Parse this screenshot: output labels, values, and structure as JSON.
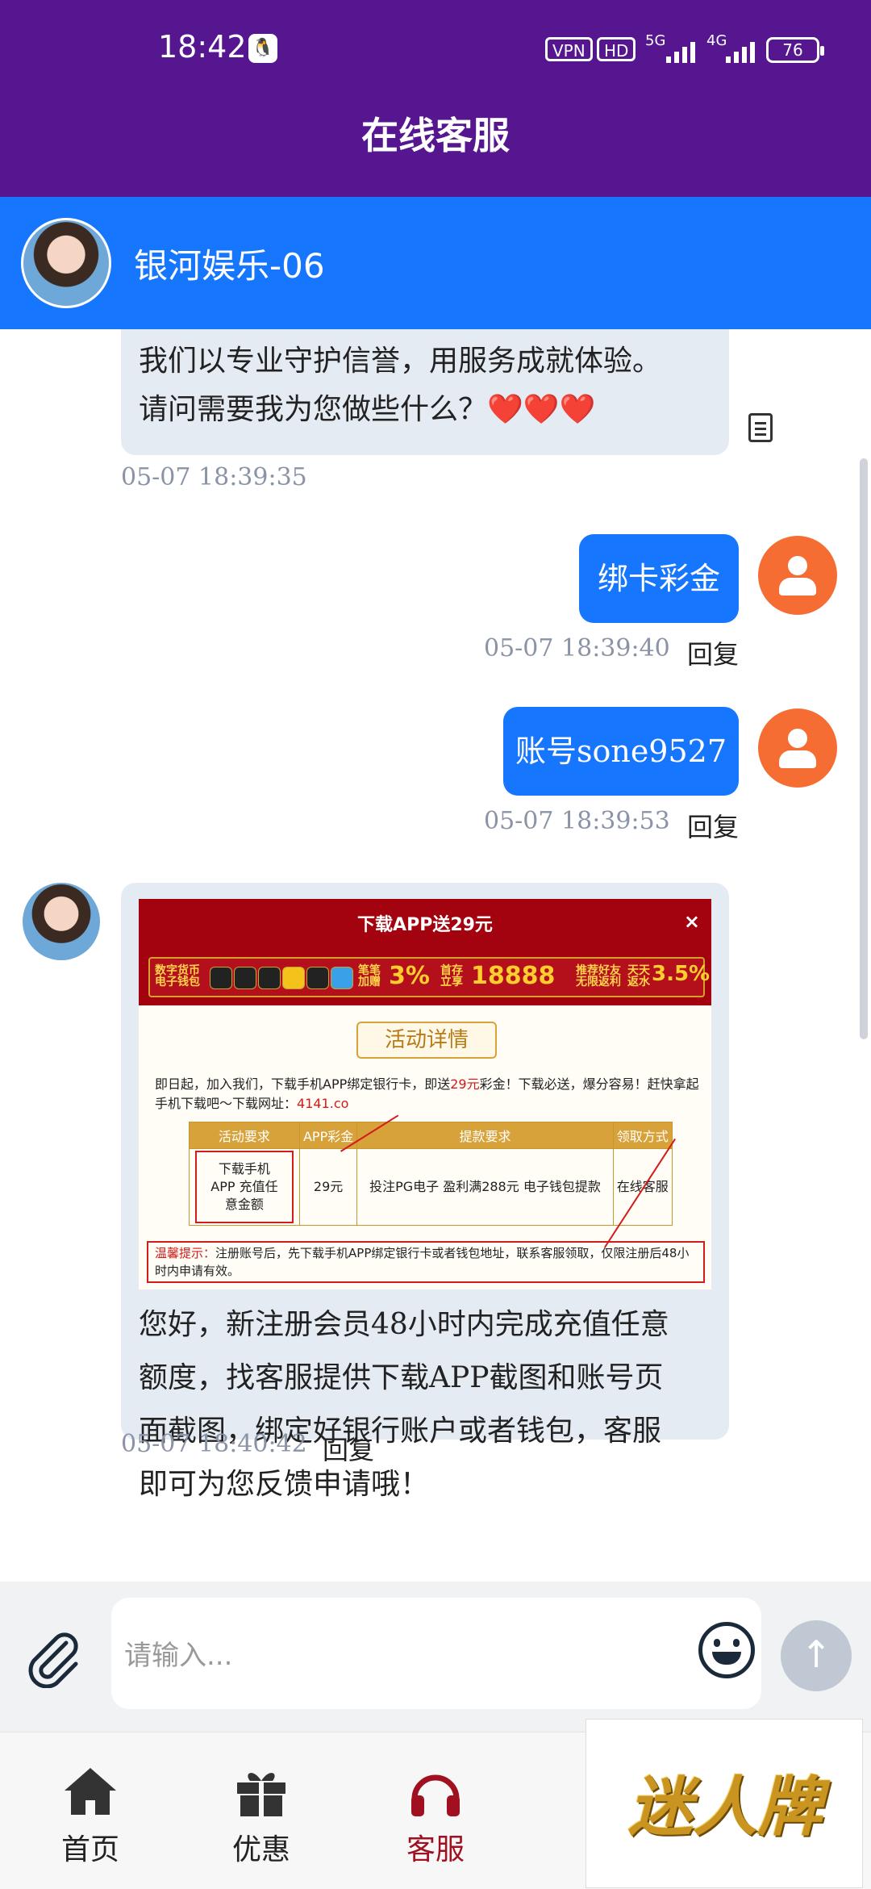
{
  "status_bar": {
    "time": "18:42",
    "vpn": "VPN",
    "hd": "HD",
    "net1": "5G",
    "net2": "4G",
    "battery": "76"
  },
  "header": {
    "title": "在线客服"
  },
  "agent": {
    "name": "银河娱乐-06"
  },
  "messages": {
    "m1": {
      "line1": "我们以专业守护信誉，用服务成就体验。",
      "line2": "请问需要我为您做些什么？❤️❤️❤️",
      "time": "05-07 18:39:35"
    },
    "m2": {
      "text": "绑卡彩金",
      "time": "05-07 18:39:40",
      "reply": "回复"
    },
    "m3": {
      "text": "账号sone9527",
      "time": "05-07 18:39:53",
      "reply": "回复"
    },
    "m4": {
      "line1": "您好，新注册会员48小时内完成充值任意",
      "line2": "额度，找客服提供下载APP截图和账号页",
      "line3": "面截图，绑定好银行账户或者钱包，客服",
      "line4": "即可为您反馈申请哦！",
      "time": "05-07 18:40:42",
      "reply": "回复"
    }
  },
  "promo": {
    "title": "下载APP送29元",
    "close": "×",
    "strip": {
      "wallet": "数字货币 电子钱包",
      "each": "笔笔 加赠",
      "each_pct": "3%",
      "first": "首存 立享",
      "first_amt": "18888",
      "refer": "推荐好友 无限返利",
      "daily": "天天 返水",
      "daily_pct": "3.5%"
    },
    "detail": "活动详情",
    "intro_a": "即日起，加入我们，下载手机APP绑定银行卡，即送",
    "intro_red": "29元",
    "intro_b": "彩金！下载必送，爆分容易！赶快拿起手机下载吧～下载网址：",
    "intro_url": "4141.co",
    "table": {
      "headers": [
        "活动要求",
        "APP彩金",
        "提款要求",
        "领取方式"
      ],
      "row": [
        "下载手机APP 充值任意金额",
        "29元",
        "投注PG电子 盈利满288元 电子钱包提款",
        "在线客服"
      ]
    },
    "tip_label": "温馨提示：",
    "tip_text": "注册账号后，先下载手机APP绑定银行卡或者钱包地址，联系客服领取，仅限注册后48小时内申请有效。"
  },
  "input": {
    "placeholder": "请输入..."
  },
  "nav": [
    {
      "label": "首页",
      "icon": "home-icon"
    },
    {
      "label": "优惠",
      "icon": "gift-icon"
    },
    {
      "label": "客服",
      "icon": "headset-icon"
    }
  ],
  "logo": {
    "text": "迷人牌"
  },
  "colors": {
    "header": "#55168f",
    "agent_bar": "#1677fe",
    "bubble_out": "#1677fe",
    "bubble_in": "#e5ebf3",
    "user_avatar": "#f66d34",
    "nav_active": "#a01020"
  }
}
